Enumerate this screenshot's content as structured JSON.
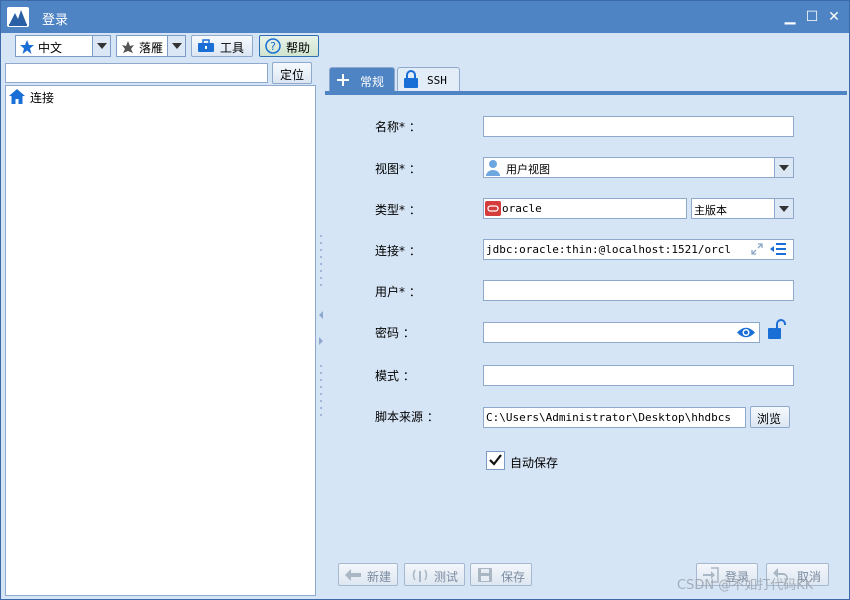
{
  "window": {
    "title": "登录"
  },
  "toolbar": {
    "language": "中文",
    "theme": "落雁",
    "tools_label": "工具",
    "help_label": "帮助"
  },
  "left": {
    "search_placeholder": "",
    "locate_label": "定位",
    "tree_root": "连接"
  },
  "tabs": [
    {
      "label": "常规",
      "active": true
    },
    {
      "label": "SSH",
      "active": false
    }
  ],
  "form": {
    "name_label": "名称* ：",
    "name_value": "",
    "view_label": "视图* ：",
    "view_value": "用户视图",
    "type_label": "类型* ：",
    "type_value": "oracle",
    "type_version": "主版本",
    "conn_label": "连接* ：",
    "conn_value": "jdbc:oracle:thin:@localhost:1521/orcl",
    "user_label": "用户* ：",
    "user_value": "",
    "password_label": "密码 ：",
    "password_value": "",
    "schema_label": "模式 ：",
    "schema_value": "",
    "script_label": "脚本来源 ：",
    "script_value": "C:\\Users\\Administrator\\Desktop\\hhdbcs",
    "browse_label": "浏览",
    "autosave_label": "自动保存",
    "autosave_checked": true
  },
  "footer": {
    "new_label": "新建",
    "test_label": "测试",
    "save_label": "保存",
    "login_label": "登录",
    "cancel_label": "取消"
  },
  "watermark": "CSDN @不如打代码KK",
  "colors": {
    "titlebar": "#4e83c4",
    "accent": "#1a6fd6",
    "background": "#d6e5f6"
  }
}
